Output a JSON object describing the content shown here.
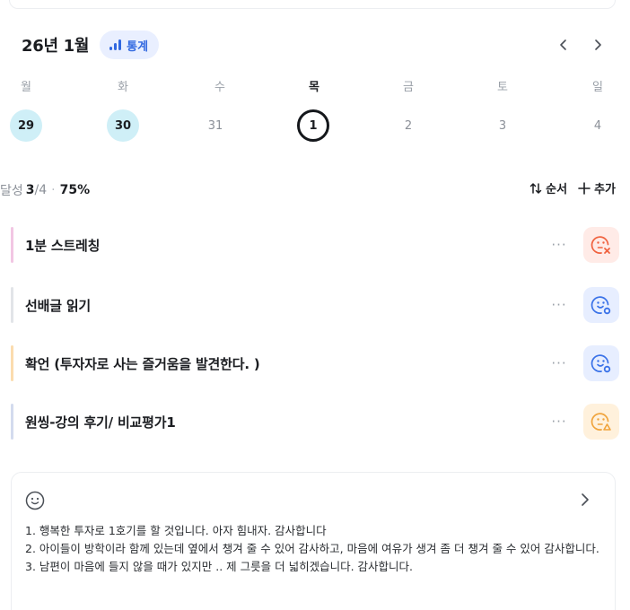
{
  "header": {
    "month_title": "26년 1월",
    "stats_label": "통계",
    "prev_icon": "chevron-left-icon",
    "next_icon": "chevron-right-icon"
  },
  "week": {
    "weekdays": [
      "월",
      "화",
      "수",
      "목",
      "금",
      "토",
      "일"
    ],
    "dates": [
      "29",
      "30",
      "31",
      "1",
      "2",
      "3",
      "4"
    ],
    "states": [
      "done",
      "done",
      "plain",
      "today",
      "plain",
      "plain",
      "plain"
    ]
  },
  "summary": {
    "label": "달성",
    "done": "3",
    "total": "/4",
    "separator": "·",
    "percent": "75%"
  },
  "actions": {
    "sort_label": "순서",
    "add_label": "추가"
  },
  "habits": [
    {
      "name": "1분 스트레칭",
      "color": "#f2c6e3",
      "status": "fail",
      "status_icon": "face-x-icon"
    },
    {
      "name": "선배글 읽기",
      "color": "#e2e4e8",
      "status": "done",
      "status_icon": "face-check-icon"
    },
    {
      "name": "확언 (투자자로 사는 즐거움을 발견한다. )",
      "color": "#fbdcae",
      "status": "done",
      "status_icon": "face-check-icon"
    },
    {
      "name": "원씽-강의 후기/ 비교평가1",
      "color": "#d3dbee",
      "status": "partial",
      "status_icon": "face-warning-icon"
    }
  ],
  "more_label": "···",
  "colors": {
    "fail": "#f0623f",
    "done": "#3a72e8",
    "partial": "#f0a43c",
    "accent": "#3168e0",
    "done_date_bg": "#cfeff7"
  },
  "note": {
    "icon": "smile-icon",
    "lines": [
      "1. 행복한 투자로 1호기를 할 것입니다. 아자 힘내자. 감사합니다",
      "2. 아이들이 방학이라 함께 있는데 옆에서 챙겨 줄 수 있어 감사하고, 마음에 여유가 생겨 좀 더 챙겨 줄 수 있어 감사합니다.",
      "3. 남편이 마음에 들지 않을 때가 있지만 .. 제 그릇을 더 넓히겠습니다. 감사합니다."
    ]
  }
}
